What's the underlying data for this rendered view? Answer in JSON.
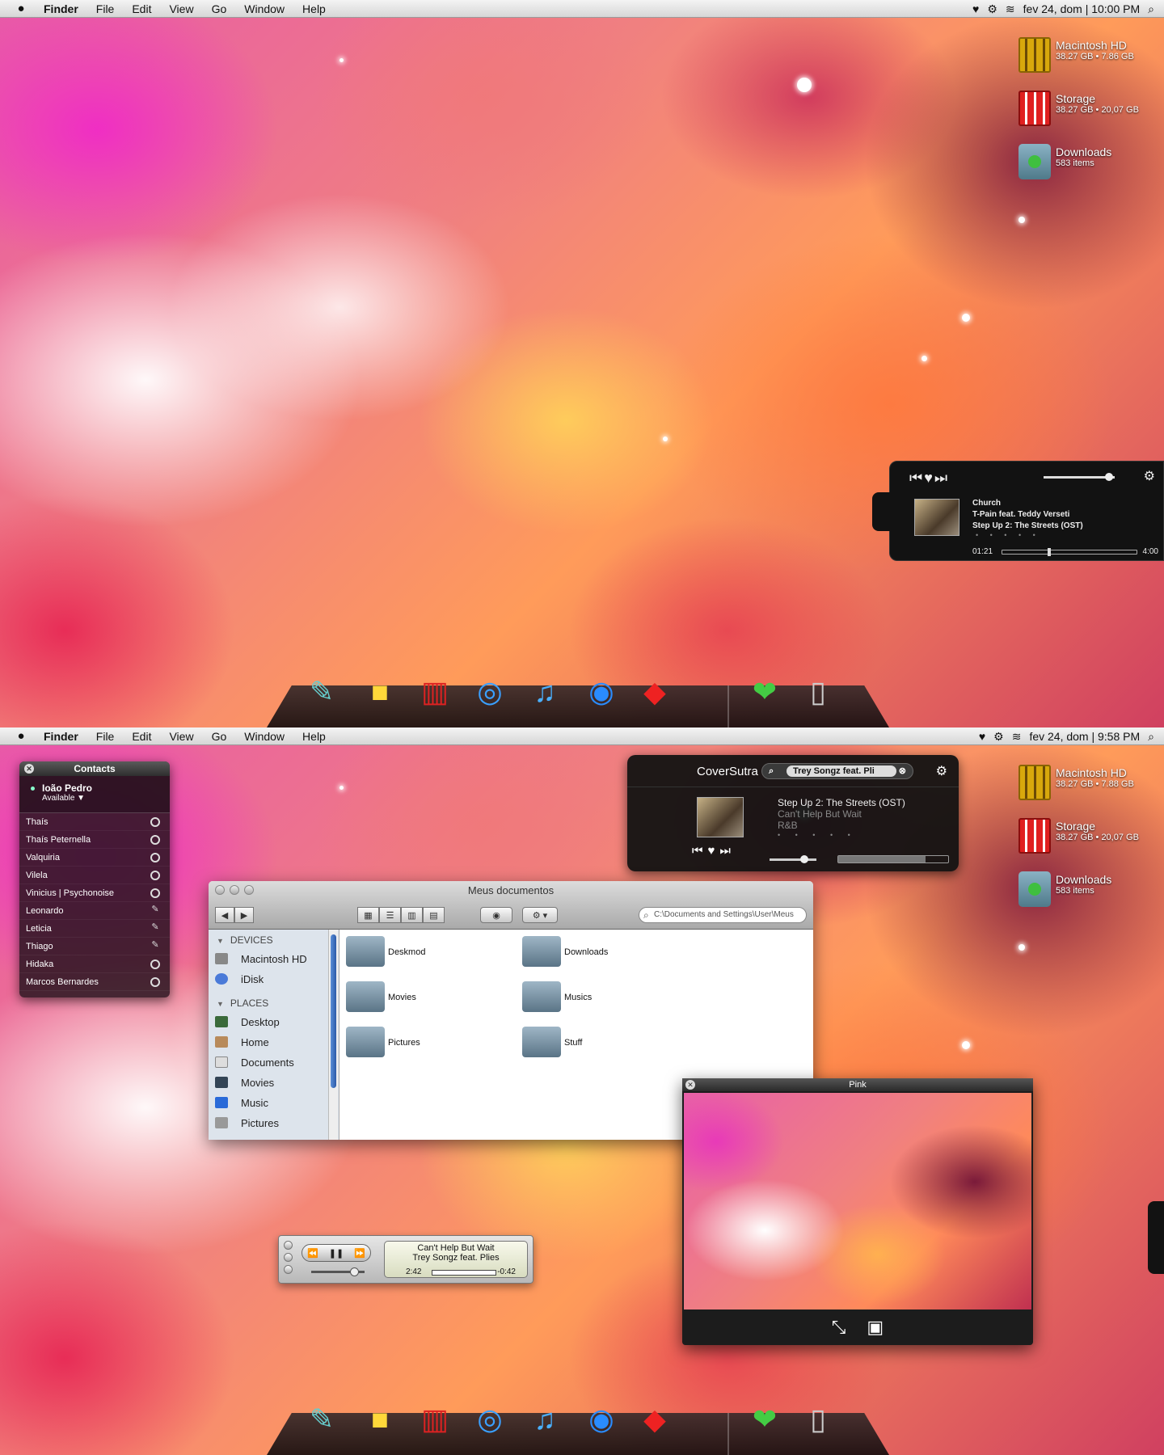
{
  "screens": [
    {
      "menubar": {
        "apple": "",
        "app": "Finder",
        "menus": [
          "File",
          "Edit",
          "View",
          "Go",
          "Window",
          "Help"
        ],
        "clock": "fev 24, dom | 10:00 PM"
      },
      "desktop_icons": [
        {
          "name": "Macintosh HD",
          "sub": "38.27 GB • 7.86 GB"
        },
        {
          "name": "Storage",
          "sub": "38.27 GB • 20,07 GB"
        },
        {
          "name": "Downloads",
          "sub": "583 items"
        }
      ],
      "player": {
        "song": "Church",
        "artist": "T-Pain feat. Teddy Verseti",
        "album": "Step Up 2: The Streets (OST)",
        "elapsed": "01:21",
        "total": "4:00",
        "stars": "• • • • •"
      }
    },
    {
      "menubar": {
        "apple": "",
        "app": "Finder",
        "menus": [
          "File",
          "Edit",
          "View",
          "Go",
          "Window",
          "Help"
        ],
        "clock": "fev 24, dom | 9:58 PM"
      },
      "desktop_icons": [
        {
          "name": "Macintosh HD",
          "sub": "38.27 GB • 7.88 GB"
        },
        {
          "name": "Storage",
          "sub": "38.27 GB • 20,07 GB"
        },
        {
          "name": "Downloads",
          "sub": "583 items"
        }
      ]
    }
  ],
  "contacts": {
    "title": "Contacts",
    "me": {
      "name": "Ioão Pedro",
      "status": "Available ▼"
    },
    "list": [
      "Thaís",
      "Thaís Peternella",
      "Valquiria",
      "Vilela",
      "Vinicius | Psychonoise",
      "Leonardo",
      "Leticia",
      "Thiago",
      "Hidaka",
      "Marcos Bernardes"
    ]
  },
  "coversutra": {
    "brand": "CoverSutra",
    "search": "Trey Songz feat. Pli",
    "album": "Step Up 2: The Streets (OST)",
    "song": "Can't Help But Wait",
    "genre": "R&B",
    "stars": "• • • • •"
  },
  "finder": {
    "title": "Meus documentos",
    "search_placeholder": "C:\\Documents and Settings\\User\\Meus",
    "devices_header": "DEVICES",
    "devices": [
      "Macintosh HD",
      "iDisk"
    ],
    "places_header": "PLACES",
    "places": [
      "Desktop",
      "Home",
      "Documents",
      "Movies",
      "Music",
      "Pictures"
    ],
    "files": [
      "Deskmod",
      "Downloads",
      "Movies",
      "Musics",
      "Pictures",
      "Stuff"
    ]
  },
  "preview": {
    "title": "Pink"
  },
  "itunes_mini": {
    "song": "Can't Help But Wait",
    "artist": "Trey Songz feat. Plies",
    "elapsed": "2:42",
    "remaining": "-0:42"
  },
  "colors": {
    "accent": "#e85aa8",
    "player_bg": "#121212",
    "sidebar_bg": "#dde4ec"
  }
}
